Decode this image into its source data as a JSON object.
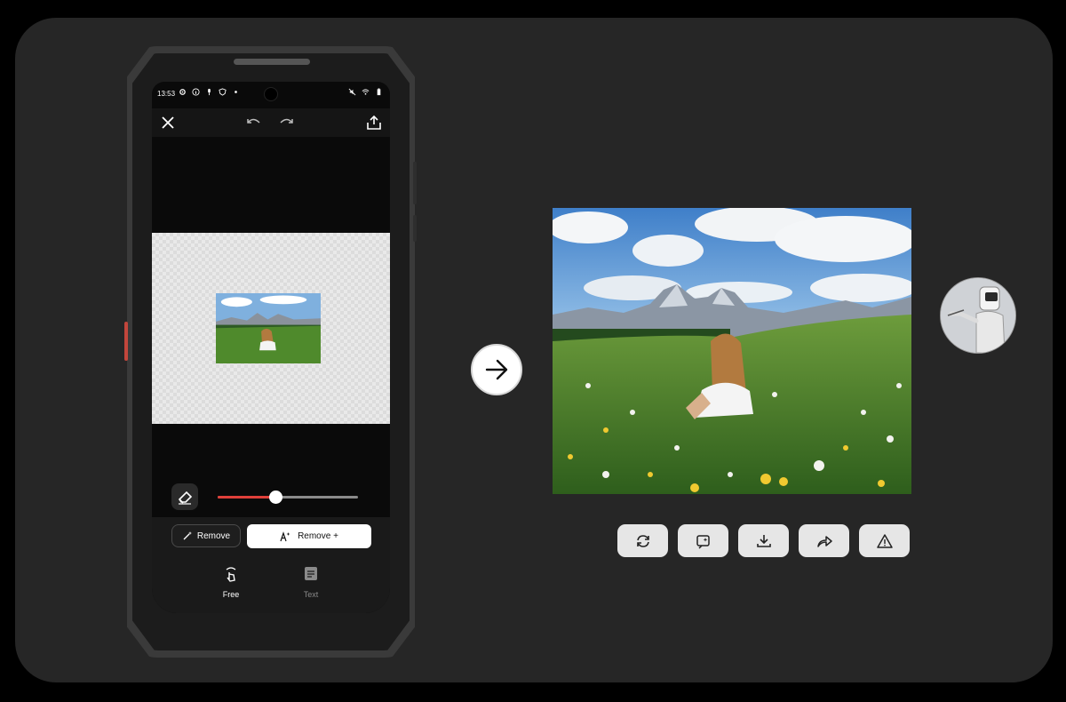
{
  "status_bar": {
    "time": "13:53"
  },
  "editor": {
    "remove_label": "Remove",
    "remove_plus_label": "Remove +",
    "brush_size_fraction": 0.41
  },
  "nav": {
    "free_label": "Free",
    "text_label": "Text"
  },
  "colors": {
    "accent": "#e0403a",
    "card_bg": "#262626",
    "action_button_bg": "#e6e6e6"
  },
  "result_actions": [
    {
      "icon": "regenerate-icon"
    },
    {
      "icon": "edit-image-icon"
    },
    {
      "icon": "download-icon"
    },
    {
      "icon": "share-icon"
    },
    {
      "icon": "report-icon"
    }
  ]
}
